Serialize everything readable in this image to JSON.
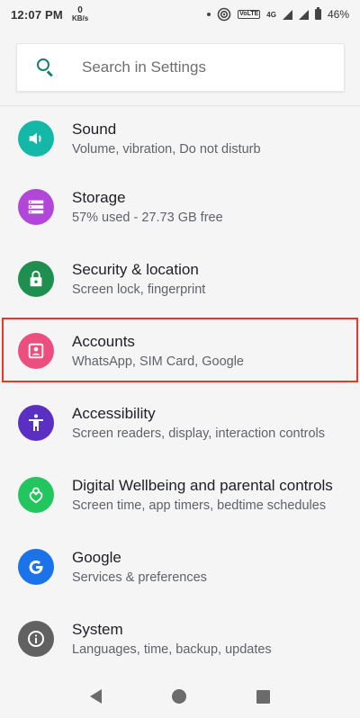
{
  "status_bar": {
    "time": "12:07 PM",
    "speed_value": "0",
    "speed_unit": "KB/s",
    "volte": "VoLTE",
    "network": "4G",
    "battery": "46%"
  },
  "search": {
    "placeholder": "Search in Settings"
  },
  "items": [
    {
      "title": "Sound",
      "subtitle": "Volume, vibration, Do not disturb",
      "color": "#14b8a6",
      "icon": "volume-icon"
    },
    {
      "title": "Storage",
      "subtitle": "57% used - 27.73 GB free",
      "color": "#b146d8",
      "icon": "storage-icon"
    },
    {
      "title": "Security & location",
      "subtitle": "Screen lock, fingerprint",
      "color": "#1e8f4e",
      "icon": "lock-icon"
    },
    {
      "title": "Accounts",
      "subtitle": "WhatsApp, SIM Card, Google",
      "color": "#ec4f7f",
      "icon": "account-icon"
    },
    {
      "title": "Accessibility",
      "subtitle": "Screen readers, display, interaction controls",
      "color": "#5b2fc2",
      "icon": "accessibility-icon"
    },
    {
      "title": "Digital Wellbeing and parental controls",
      "subtitle": "Screen time, app timers, bedtime schedules",
      "color": "#22c55e",
      "icon": "wellbeing-icon"
    },
    {
      "title": "Google",
      "subtitle": "Services & preferences",
      "color": "#1a73e8",
      "icon": "google-icon"
    },
    {
      "title": "System",
      "subtitle": "Languages, time, backup, updates",
      "color": "#616161",
      "icon": "info-icon"
    }
  ]
}
